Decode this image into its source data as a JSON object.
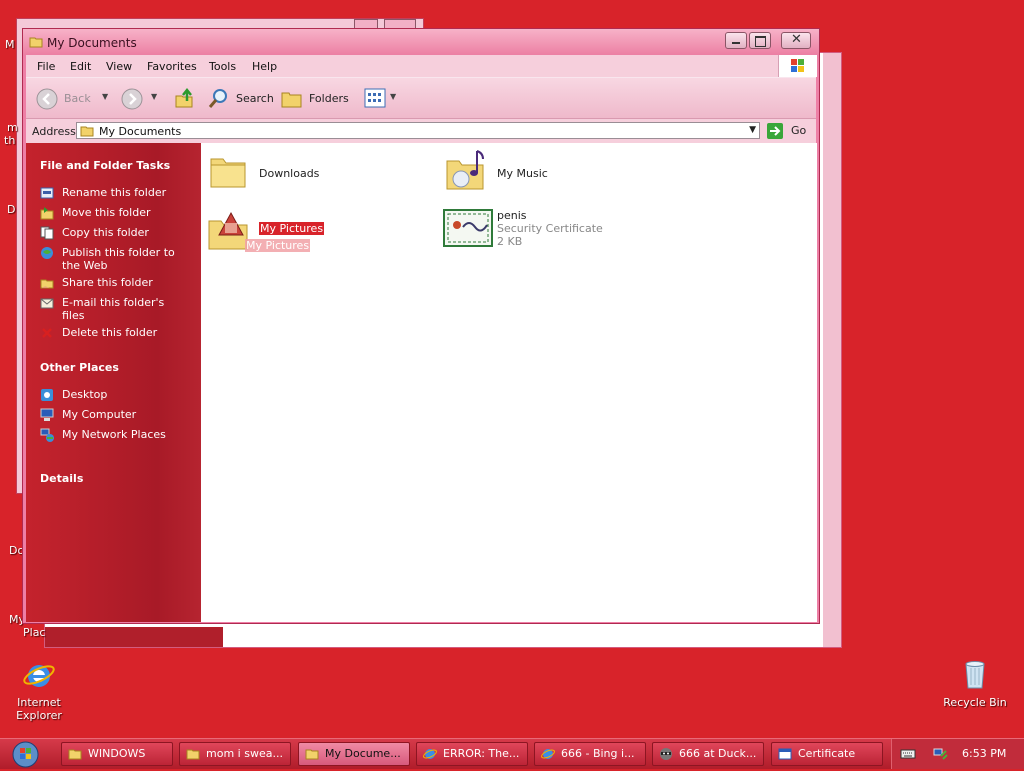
{
  "desktop": {
    "icons": [
      {
        "label": "Internet Explorer",
        "icon": "internet-explorer-icon"
      },
      {
        "label": "Recycle Bin",
        "icon": "recycle-bin-icon"
      }
    ],
    "partial_labels": [
      "M",
      "m",
      "th",
      "D",
      "Do",
      "My",
      "Plac"
    ]
  },
  "window": {
    "title": "My Documents",
    "menu": [
      "File",
      "Edit",
      "View",
      "Favorites",
      "Tools",
      "Help"
    ],
    "toolbar": {
      "back": "Back",
      "search": "Search",
      "folders": "Folders"
    },
    "address": {
      "label": "Address",
      "value": "My Documents",
      "go": "Go"
    },
    "tasks": {
      "title": "File and Folder Tasks",
      "items": [
        {
          "label": "Rename this folder",
          "icon": "rename-icon"
        },
        {
          "label": "Move this folder",
          "icon": "move-icon"
        },
        {
          "label": "Copy this folder",
          "icon": "copy-icon"
        },
        {
          "label": "Publish this folder to the Web",
          "icon": "publish-web-icon"
        },
        {
          "label": "Share this folder",
          "icon": "share-icon"
        },
        {
          "label": "E-mail this folder's files",
          "icon": "email-icon"
        },
        {
          "label": "Delete this folder",
          "icon": "delete-icon"
        }
      ]
    },
    "other_places": {
      "title": "Other Places",
      "items": [
        {
          "label": "Desktop",
          "icon": "desktop-icon"
        },
        {
          "label": "My Computer",
          "icon": "my-computer-icon"
        },
        {
          "label": "My Network Places",
          "icon": "network-places-icon"
        }
      ]
    },
    "details": {
      "title": "Details"
    },
    "files": [
      {
        "name": "Downloads",
        "icon": "folder-icon"
      },
      {
        "name": "My Music",
        "icon": "music-folder-icon"
      },
      {
        "name": "My Pictures",
        "icon": "pictures-folder-icon",
        "selected": true,
        "drag_ghost": "My Pictures"
      },
      {
        "name": "penis",
        "type": "Security Certificate",
        "size": "2 KB",
        "icon": "certificate-icon"
      }
    ]
  },
  "taskbar": {
    "buttons": [
      {
        "label": "WINDOWS",
        "icon": "folder-icon"
      },
      {
        "label": "mom i swea...",
        "icon": "folder-icon"
      },
      {
        "label": "My Docume...",
        "icon": "folder-icon",
        "active": true
      },
      {
        "label": "ERROR: The...",
        "icon": "internet-explorer-icon"
      },
      {
        "label": "666 - Bing i...",
        "icon": "internet-explorer-icon"
      },
      {
        "label": "666 at Duck...",
        "icon": "raccoon-icon"
      },
      {
        "label": "Certificate",
        "icon": "window-icon"
      }
    ],
    "clock": "6:53 PM"
  },
  "colors": {
    "desktop": "#d8232a",
    "window_frame": "#ee7fa6",
    "task_pane": "#b21e2a",
    "selection": "#d8232a"
  }
}
